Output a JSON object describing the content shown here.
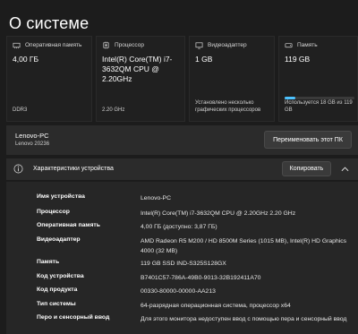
{
  "page_title": "О системе",
  "cards": [
    {
      "header": "Оперативная память",
      "icon": "ram-icon",
      "value": "4,00 ГБ",
      "footer": "DDR3"
    },
    {
      "header": "Процессор",
      "icon": "processor-icon",
      "value": "Intel(R) Core(TM) i7-3632QM CPU @ 2.20GHz",
      "footer": "2.20 GHz"
    },
    {
      "header": "Видеоадаптер",
      "icon": "display-adapter-icon",
      "value": "1 GB",
      "footer": "Установлено несколько графических процессоров"
    },
    {
      "header": "Память",
      "icon": "storage-icon",
      "value": "119 GB",
      "footer": "Используется 18 GB из 119 GB",
      "used_fraction": 0.15
    }
  ],
  "device": {
    "name": "Lenovo-PC",
    "model": "Lenovo 20236",
    "rename_label": "Переименовать этот ПК"
  },
  "specs": {
    "title": "Характеристики устройства",
    "copy_label": "Копировать",
    "rows": [
      {
        "key": "Имя устройства",
        "value": "Lenovo-PC"
      },
      {
        "key": "Процессор",
        "value": "Intel(R) Core(TM) i7-3632QM CPU @ 2.20GHz   2.20 GHz"
      },
      {
        "key": "Оперативная память",
        "value": "4,00 ГБ (доступно: 3,87 ГБ)"
      },
      {
        "key": "Видеоадаптер",
        "value": "AMD Radeon R5 M200 / HD 8500M Series (1015 MB), Intel(R) HD Graphics 4000 (32 MB)"
      },
      {
        "key": "Память",
        "value": "119 GB SSD IND-S325S128GX"
      },
      {
        "key": "Код устройства",
        "value": "B7401C57-786A-49B0-9013-32B192411A70"
      },
      {
        "key": "Код продукта",
        "value": "00330-80000-00000-AA213"
      },
      {
        "key": "Тип системы",
        "value": "64-разрядная операционная система, процессор x64"
      },
      {
        "key": "Перо и сенсорный ввод",
        "value": "Для этого монитора недоступен ввод с помощью пера и сенсорный ввод"
      }
    ]
  }
}
